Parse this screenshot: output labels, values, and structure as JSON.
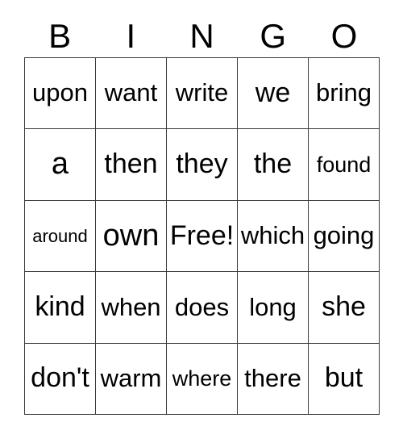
{
  "card": {
    "title": "BINGO",
    "free_space_label": "Free!",
    "border_color": "#3a3a3a",
    "text_color": "#000000",
    "background_color": "#ffffff",
    "columns": 5,
    "rows": 5
  },
  "header": {
    "letters": [
      {
        "label": "B"
      },
      {
        "label": "I"
      },
      {
        "label": "N"
      },
      {
        "label": "G"
      },
      {
        "label": "O"
      }
    ]
  },
  "grid": {
    "rows": [
      {
        "cells": [
          {
            "label": "upon",
            "size": "md",
            "free": false
          },
          {
            "label": "want",
            "size": "md",
            "free": false
          },
          {
            "label": "write",
            "size": "md",
            "free": false
          },
          {
            "label": "we",
            "size": "lg",
            "free": false
          },
          {
            "label": "bring",
            "size": "md",
            "free": false
          }
        ]
      },
      {
        "cells": [
          {
            "label": "a",
            "size": "xl",
            "free": false
          },
          {
            "label": "then",
            "size": "lg",
            "free": false
          },
          {
            "label": "they",
            "size": "lg",
            "free": false
          },
          {
            "label": "the",
            "size": "lg",
            "free": false
          },
          {
            "label": "found",
            "size": "sm",
            "free": false
          }
        ]
      },
      {
        "cells": [
          {
            "label": "around",
            "size": "xs",
            "free": false
          },
          {
            "label": "own",
            "size": "xl",
            "free": false
          },
          {
            "label": "Free!",
            "size": "lg",
            "free": true
          },
          {
            "label": "which",
            "size": "md",
            "free": false
          },
          {
            "label": "going",
            "size": "md",
            "free": false
          }
        ]
      },
      {
        "cells": [
          {
            "label": "kind",
            "size": "lg",
            "free": false
          },
          {
            "label": "when",
            "size": "md",
            "free": false
          },
          {
            "label": "does",
            "size": "md",
            "free": false
          },
          {
            "label": "long",
            "size": "md",
            "free": false
          },
          {
            "label": "she",
            "size": "lg",
            "free": false
          }
        ]
      },
      {
        "cells": [
          {
            "label": "don't",
            "size": "lg",
            "free": false
          },
          {
            "label": "warm",
            "size": "md",
            "free": false
          },
          {
            "label": "where",
            "size": "sm",
            "free": false
          },
          {
            "label": "there",
            "size": "md",
            "free": false
          },
          {
            "label": "but",
            "size": "lg",
            "free": false
          }
        ]
      }
    ]
  }
}
